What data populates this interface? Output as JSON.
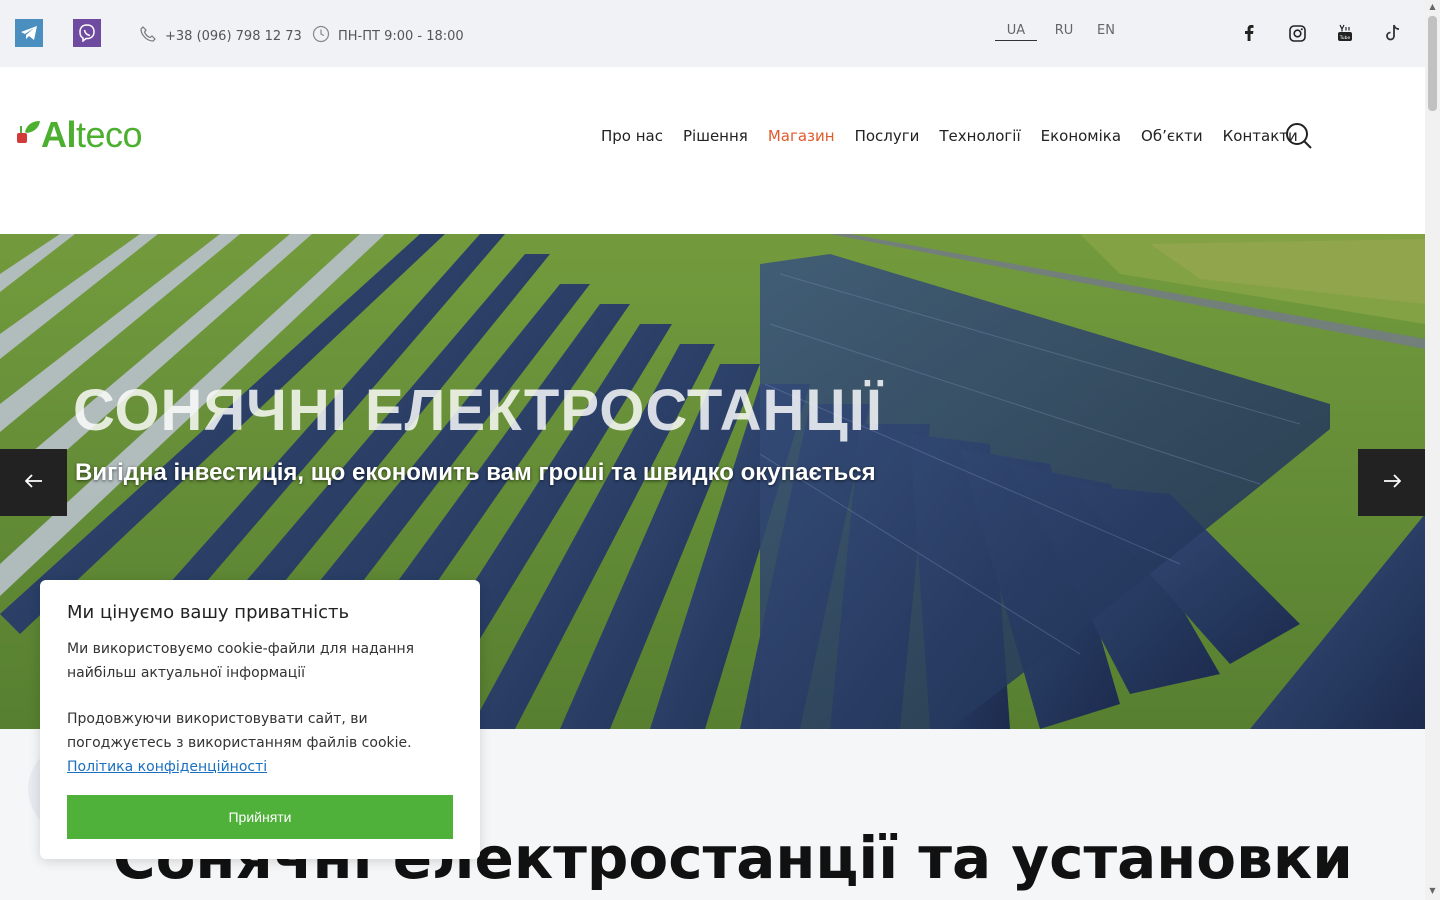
{
  "topbar": {
    "phone": "+38 (096) 798 12 73",
    "hours": "ПН-ПТ 9:00 - 18:00",
    "languages": [
      "UA",
      "RU",
      "EN"
    ],
    "active_language": "UA",
    "social_icons": [
      "facebook-icon",
      "instagram-icon",
      "youtube-icon",
      "tiktok-icon"
    ],
    "messengers": [
      "telegram-icon",
      "viber-icon"
    ]
  },
  "header": {
    "logo": {
      "part1": "Al",
      "part2": "teco"
    },
    "nav": [
      "Про нас",
      "Рішення",
      "Магазин",
      "Послуги",
      "Технології",
      "Економіка",
      "Об’єкти",
      "Контакти"
    ],
    "active_nav": "Магазин"
  },
  "hero": {
    "title": "СОНЯЧНІ ЕЛЕКТРОСТАНЦІЇ",
    "subtitle": "Вигідна інвестиція, що економить вам гроші та швидко окупається"
  },
  "section": {
    "title": "Сонячні електростанції та установки"
  },
  "cookie": {
    "title": "Ми цінуємо вашу приватність",
    "text1": "Ми використовуємо cookie-файли для надання найбільш актуальної інформації",
    "text2": "Продовжуючи використовувати сайт, ви погоджуєтесь з використанням файлів cookie.",
    "link": "Політика конфіденційності",
    "accept": "Прийняти"
  },
  "colors": {
    "brand_green": "#4caf30",
    "nav_active": "#e05a2b",
    "accept_button": "#4fb03a",
    "link": "#1a6fc0"
  }
}
